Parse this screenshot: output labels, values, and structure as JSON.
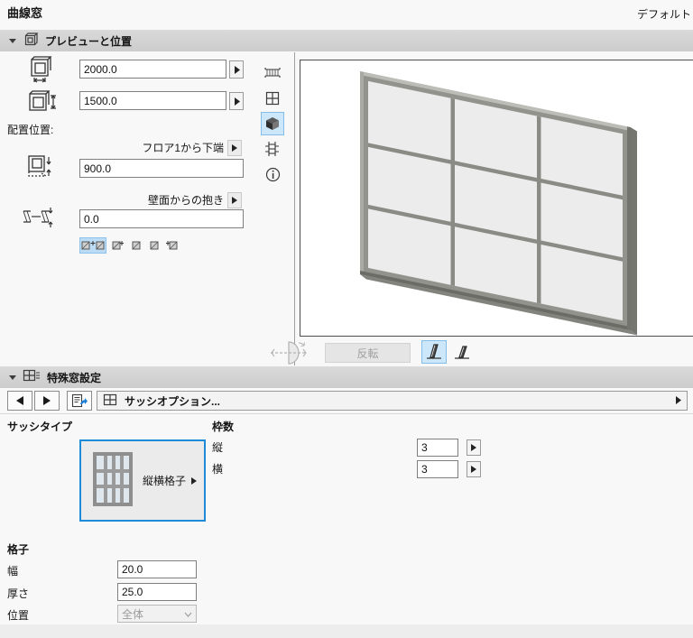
{
  "titlebar": {
    "title": "曲線窓",
    "preset": "デフォルト"
  },
  "preview_section": {
    "title": "プレビューと位置",
    "flip_button": "反転"
  },
  "fields": {
    "width_value": "2000.0",
    "height_value": "1500.0",
    "placement_label": "配置位置:",
    "anchor_ref_label": "フロア1から下端",
    "sill_value": "900.0",
    "reveal_label": "壁面からの抱き",
    "reveal_value": "0.0"
  },
  "special_section": {
    "title": "特殊窓設定",
    "options_menu": "サッシオプション...",
    "sash_type_label": "サッシタイプ",
    "sash_type_value": "縦横格子",
    "frame_count_label": "枠数",
    "vertical_label": "縦",
    "vertical_value": "3",
    "horizontal_label": "横",
    "horizontal_value": "3",
    "lattice_label": "格子",
    "lattice_width_label": "幅",
    "lattice_width_value": "20.0",
    "lattice_thickness_label": "厚さ",
    "lattice_thickness_value": "25.0",
    "lattice_position_label": "位置",
    "lattice_position_value": "全体"
  },
  "icons": {
    "toolbar": [
      "plan-view-icon",
      "elevation-view-icon",
      "3d-view-icon",
      "section-view-icon",
      "info-icon"
    ],
    "selection_color": "#cce6fa",
    "accent_color": "#1e8bd8",
    "header_bg": "#d2d2d2"
  }
}
